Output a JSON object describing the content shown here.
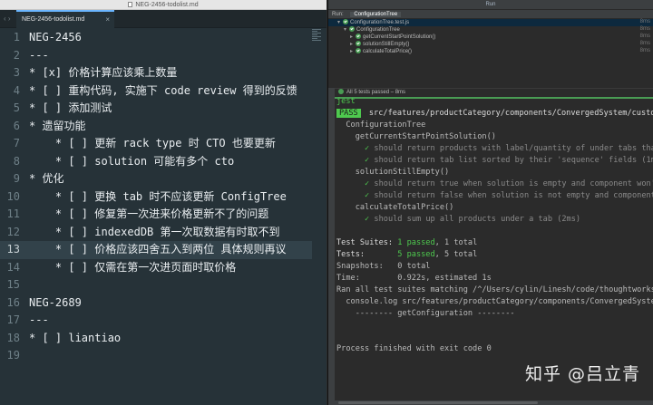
{
  "editor": {
    "window_title": "NEG-2456-todolist.md",
    "tab_label": "NEG-2456-todolist.md",
    "tab_close": "×",
    "tab_scroll": "‹ ›",
    "active_line": 13,
    "lines": [
      {
        "n": "1",
        "text": "NEG-2456"
      },
      {
        "n": "2",
        "text": "---"
      },
      {
        "n": "3",
        "text": "* [x] 价格计算应该乘上数量"
      },
      {
        "n": "4",
        "text": "* [ ] 重构代码, 实施下 code review 得到的反馈"
      },
      {
        "n": "5",
        "text": "* [ ] 添加测试"
      },
      {
        "n": "6",
        "text": "* 遗留功能"
      },
      {
        "n": "7",
        "text": "    * [ ] 更新 rack type 时 CTO 也要更新"
      },
      {
        "n": "8",
        "text": "    * [ ] solution 可能有多个 cto"
      },
      {
        "n": "9",
        "text": "* 优化"
      },
      {
        "n": "10",
        "text": "    * [ ] 更换 tab 时不应该更新 ConfigTree"
      },
      {
        "n": "11",
        "text": "    * [ ] 修复第一次进来价格更新不了的问题"
      },
      {
        "n": "12",
        "text": "    * [ ] indexedDB 第一次取数据有时取不到"
      },
      {
        "n": "13",
        "text": "    * [ ] 价格应该四舍五入到两位 具体规则再议"
      },
      {
        "n": "14",
        "text": "    * [ ] 仅需在第一次进页面时取价格"
      },
      {
        "n": "15",
        "text": ""
      },
      {
        "n": "16",
        "text": "NEG-2689"
      },
      {
        "n": "17",
        "text": "---"
      },
      {
        "n": "18",
        "text": "* [ ] liantiao"
      },
      {
        "n": "19",
        "text": ""
      }
    ]
  },
  "run_panel": {
    "window_title": "Run",
    "tabs": [
      {
        "label": "Run:"
      },
      {
        "label": "ConfigurationTree"
      }
    ],
    "tree": [
      {
        "label": "ConfigurationTree.test.js",
        "time": "8ms",
        "depth": 0,
        "arrow": "▾"
      },
      {
        "label": "ConfigurationTree",
        "time": "8ms",
        "depth": 1,
        "arrow": "▾"
      },
      {
        "label": "getCurrentStartPointSolution()",
        "time": "8ms",
        "depth": 2,
        "arrow": "▸"
      },
      {
        "label": "solutionStillEmpty()",
        "time": "8ms",
        "depth": 2,
        "arrow": "▸"
      },
      {
        "label": "calculateTotalPrice()",
        "time": "8ms",
        "depth": 2,
        "arrow": "▸"
      }
    ],
    "status": "All 5 tests passed – 8ms",
    "progress_fraction": 1.0,
    "console": {
      "jest": "jest",
      "pass_badge": "PASS",
      "pass_path": " src/features/productCategory/components/ConvergedSystem/customi",
      "suite": "  ConfigurationTree",
      "g1": "    getCurrentStartPointSolution()",
      "t1": "should return products with label/quantity of under tabs that",
      "t2": "should return tab list sorted by their 'sequence' fields (1ms)",
      "g2": "    solutionStillEmpty()",
      "t3": "should return true when solution is empty and component won't",
      "t4": "should return false when solution is not empty and component w",
      "g3": "    calculateTotalPrice()",
      "t5": "should sum up all products under a tab (2ms)",
      "check": "✓",
      "suites_label": "Test Suites: ",
      "suites_passed": "1 passed",
      "suites_total": ", 1 total",
      "tests_label": "Tests:       ",
      "tests_passed": "5 passed",
      "tests_total": ", 5 total",
      "snapshots": "Snapshots:   0 total",
      "time": "Time:        0.922s, estimated 1s",
      "ran_all": "Ran all test suites matching /^/Users/cylin/Linesh/code/thoughtworks/s",
      "console_log": "  console.log src/features/productCategory/components/ConvergedSystem/",
      "divider": "    -------- getConfiguration --------",
      "finished": "Process finished with exit code 0"
    },
    "watermark": "知乎 @吕立青"
  }
}
